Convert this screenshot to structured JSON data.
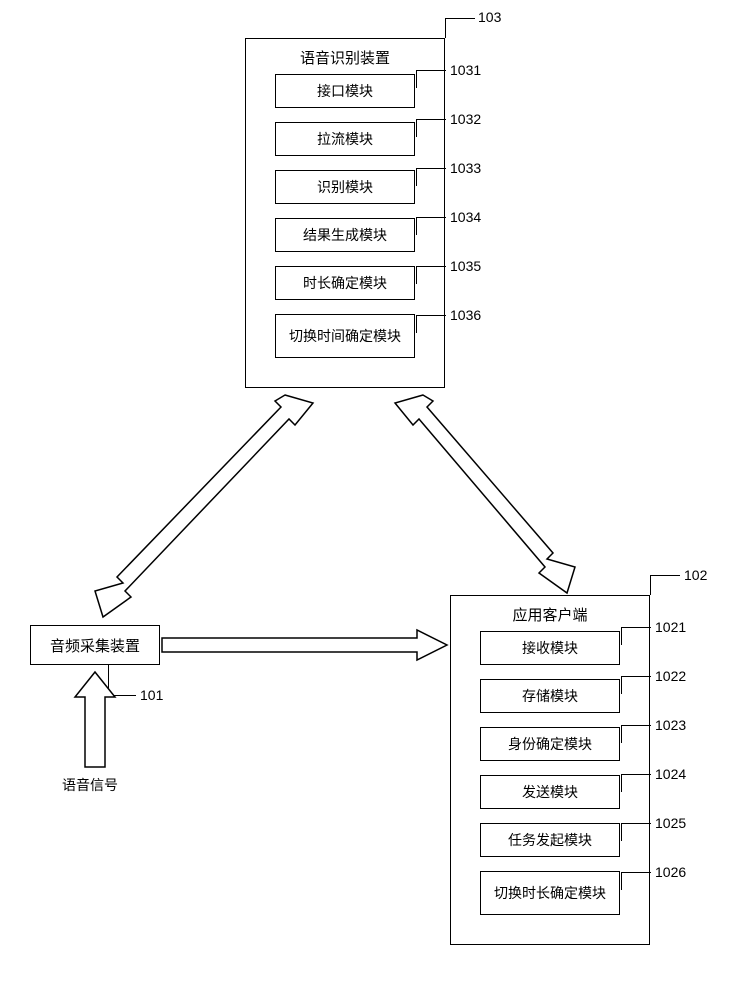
{
  "input_signal": "语音信号",
  "audio_collector": {
    "label": "音频采集装置",
    "ref": "101"
  },
  "speech_recognizer": {
    "title": "语音识别装置",
    "ref": "103",
    "modules": [
      {
        "label": "接口模块",
        "ref": "1031"
      },
      {
        "label": "拉流模块",
        "ref": "1032"
      },
      {
        "label": "识别模块",
        "ref": "1033"
      },
      {
        "label": "结果生成模块",
        "ref": "1034"
      },
      {
        "label": "时长确定模块",
        "ref": "1035"
      },
      {
        "label": "切换时间确定模块",
        "ref": "1036"
      }
    ]
  },
  "app_client": {
    "title": "应用客户端",
    "ref": "102",
    "modules": [
      {
        "label": "接收模块",
        "ref": "1021"
      },
      {
        "label": "存储模块",
        "ref": "1022"
      },
      {
        "label": "身份确定模块",
        "ref": "1023"
      },
      {
        "label": "发送模块",
        "ref": "1024"
      },
      {
        "label": "任务发起模块",
        "ref": "1025"
      },
      {
        "label": "切换时长确定模块",
        "ref": "1026"
      }
    ]
  },
  "chart_data": {
    "type": "diagram",
    "nodes": [
      {
        "id": "signal",
        "label": "语音信号"
      },
      {
        "id": "101",
        "label": "音频采集装置"
      },
      {
        "id": "102",
        "label": "应用客户端",
        "children": [
          "1021",
          "1022",
          "1023",
          "1024",
          "1025",
          "1026"
        ]
      },
      {
        "id": "103",
        "label": "语音识别装置",
        "children": [
          "1031",
          "1032",
          "1033",
          "1034",
          "1035",
          "1036"
        ]
      },
      {
        "id": "1021",
        "label": "接收模块"
      },
      {
        "id": "1022",
        "label": "存储模块"
      },
      {
        "id": "1023",
        "label": "身份确定模块"
      },
      {
        "id": "1024",
        "label": "发送模块"
      },
      {
        "id": "1025",
        "label": "任务发起模块"
      },
      {
        "id": "1026",
        "label": "切换时长确定模块"
      },
      {
        "id": "1031",
        "label": "接口模块"
      },
      {
        "id": "1032",
        "label": "拉流模块"
      },
      {
        "id": "1033",
        "label": "识别模块"
      },
      {
        "id": "1034",
        "label": "结果生成模块"
      },
      {
        "id": "1035",
        "label": "时长确定模块"
      },
      {
        "id": "1036",
        "label": "切换时间确定模块"
      }
    ],
    "edges": [
      {
        "from": "signal",
        "to": "101",
        "dir": "uni"
      },
      {
        "from": "101",
        "to": "102",
        "dir": "uni"
      },
      {
        "from": "101",
        "to": "103",
        "dir": "bi"
      },
      {
        "from": "102",
        "to": "103",
        "dir": "bi"
      }
    ]
  }
}
